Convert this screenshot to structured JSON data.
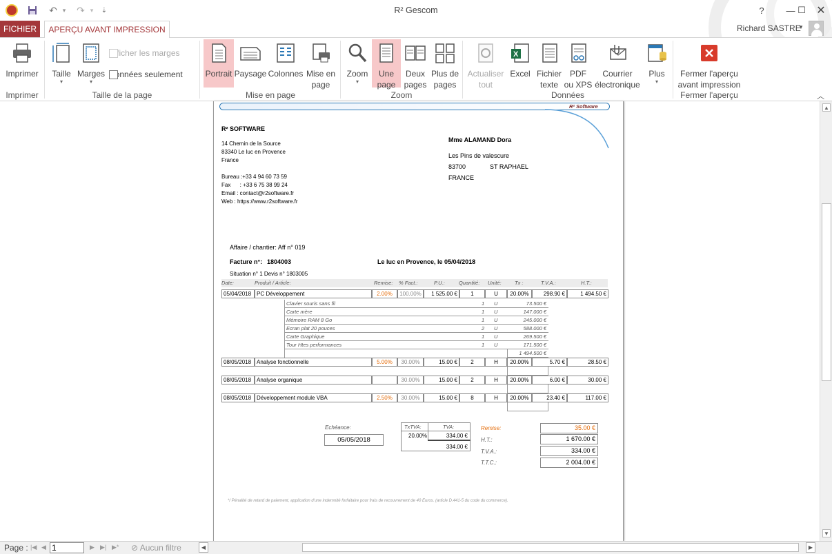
{
  "window": {
    "title": "R² Gescom"
  },
  "window_controls": {
    "help": "?",
    "restore": "⧉",
    "min": "—",
    "max": "☐",
    "close": "✕"
  },
  "tabs": {
    "fichier": "FICHIER",
    "apercu": "APERÇU AVANT IMPRESSION"
  },
  "user": {
    "name": "Richard SASTRE"
  },
  "ribbon": {
    "imprimer": {
      "label": "Imprimer",
      "group": "Imprimer"
    },
    "taille": {
      "label": "Taille"
    },
    "marges": {
      "label": "Marges"
    },
    "afficher_marges": "Afficher les marges",
    "donnees_seulement": "Données seulement",
    "group_taille": "Taille de la page",
    "portrait": "Portrait",
    "paysage": "Paysage",
    "colonnes": "Colonnes",
    "mise_en_page_1": "Mise en",
    "mise_en_page_2": "page",
    "group_mise": "Mise en page",
    "zoom": "Zoom",
    "une_page_1": "Une",
    "une_page_2": "page",
    "deux_pages_1": "Deux",
    "deux_pages_2": "pages",
    "plus_pages_1": "Plus de",
    "plus_pages_2": "pages",
    "group_zoom": "Zoom",
    "actualiser_1": "Actualiser",
    "actualiser_2": "tout",
    "excel": "Excel",
    "fichier_texte_1": "Fichier",
    "fichier_texte_2": "texte",
    "pdf_1": "PDF",
    "pdf_2": "ou XPS",
    "courrier_1": "Courrier",
    "courrier_2": "électronique",
    "plus": "Plus",
    "group_donnees": "Données",
    "fermer_1": "Fermer l'aperçu",
    "fermer_2": "avant impression",
    "group_fermer": "Fermer l'aperçu"
  },
  "status": {
    "page_label": "Page :",
    "page_value": "1",
    "filter": "Aucun filtre"
  },
  "invoice": {
    "logo": "R² Software",
    "company": {
      "name": "R² SOFTWARE",
      "addr1": "14 Chemin de la Source",
      "addr2": "83340 Le luc en Provence",
      "country": "France",
      "bureau": "Bureau :+33 4 94 60 73 59",
      "fax": "Fax      : +33 6 75 38 99 24",
      "email": "Email : contact@r2software.fr",
      "web": "Web   : https://www.r2software.fr"
    },
    "client": {
      "name": "Mme ALAMAND Dora",
      "addr1": "Les Pins de valescure",
      "zip": "83700",
      "city": "ST RAPHAEL",
      "country": "FRANCE"
    },
    "affaire": "Affaire / chantier:  Aff n° 019",
    "facture_label": "Facture n°:",
    "facture_num": "1804003",
    "place_date": "Le luc en Provence, le  05/04/2018",
    "situation": "Situation n° 1     Devis n° 1803005",
    "headers": {
      "date": "Date:",
      "produit": "Produit / Article:",
      "remise": "Remise:",
      "fact": "% Fact.:",
      "pu": "P.U.:",
      "qte": "Quantité:",
      "unite": "Unité:",
      "tx": "Tx :",
      "tva": "T.V.A.:",
      "ht": "H.T.:"
    },
    "line1": {
      "date": "05/04/2018",
      "produit": "PC Développement",
      "remise": "2.00%",
      "fact": "100.00%",
      "pu": "1 525.00 €",
      "qte": "1",
      "unite": "U",
      "tx": "20.00%",
      "tva": "298.90 €",
      "ht": "1 494.50 €"
    },
    "sublines": [
      {
        "label": "Clavier souris sans fil",
        "qte": "1",
        "u": "U",
        "total": "73.500 €"
      },
      {
        "label": "Carte mère",
        "qte": "1",
        "u": "U",
        "total": "147.000 €"
      },
      {
        "label": "Mémoire RAM 8 Go",
        "qte": "1",
        "u": "U",
        "total": "245.000 €"
      },
      {
        "label": "Ecran plat 20 pouces",
        "qte": "2",
        "u": "U",
        "total": "588.000 €"
      },
      {
        "label": "Carte Graphique",
        "qte": "1",
        "u": "U",
        "total": "269.500 €"
      },
      {
        "label": "Tour Htes performances",
        "qte": "1",
        "u": "U",
        "total": "171.500 €"
      }
    ],
    "sub_total": "1 494.500 €",
    "line2": {
      "date": "08/05/2018",
      "produit": "Analyse fonctionnelle",
      "remise": "5.00%",
      "fact": "30.00%",
      "pu": "15.00 €",
      "qte": "2",
      "unite": "H",
      "tx": "20.00%",
      "tva": "5.70 €",
      "ht": "28.50 €"
    },
    "line3": {
      "date": "08/05/2018",
      "produit": "Analyse organique",
      "remise": "",
      "fact": "30.00%",
      "pu": "15.00 €",
      "qte": "2",
      "unite": "H",
      "tx": "20.00%",
      "tva": "6.00 €",
      "ht": "30.00 €"
    },
    "line4": {
      "date": "08/05/2018",
      "produit": "Développement module VBA",
      "remise": "2.50%",
      "fact": "30.00%",
      "pu": "15.00 €",
      "qte": "8",
      "unite": "H",
      "tx": "20.00%",
      "tva": "23.40 €",
      "ht": "117.00 €"
    },
    "echeance_label": "Echéance:",
    "echeance": "05/05/2018",
    "tva_table": {
      "h1": "TxTVA:",
      "h2": "TVA:",
      "rate": "20.00%",
      "amount": "334.00 €",
      "total": "334.00 €"
    },
    "totals": {
      "remise_label": "Remise:",
      "remise": "35.00 €",
      "ht_label": "H.T.:",
      "ht": "1 670.00 €",
      "tva_label": "T.V.A.:",
      "tva": "334.00 €",
      "ttc_label": "T.T.C.:",
      "ttc": "2 004.00 €"
    },
    "footer": "*/ Pénalité de retard de paiement, application d'une indemnité forfaitaire pour frais de recouvrement de 40 Euros. (article D.441-5 du code du commerce)."
  }
}
